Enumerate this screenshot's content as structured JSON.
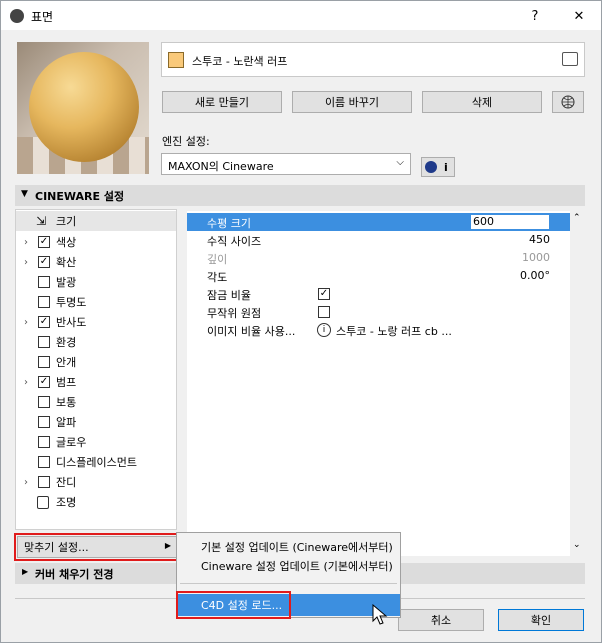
{
  "window": {
    "title": "표면",
    "help": "?",
    "close": "✕"
  },
  "material": {
    "name": "스투코 - 노란색 러프",
    "color": "#f9c97a"
  },
  "buttons": {
    "new": "새로 만들기",
    "rename": "이름 바꾸기",
    "delete": "삭제"
  },
  "engine": {
    "label": "엔진 설정:",
    "value": "MAXON의 Cineware",
    "info": "i"
  },
  "cineware": {
    "header": "CINEWARE 설정"
  },
  "channels": [
    {
      "label": "크기",
      "type": "size"
    },
    {
      "label": "색상",
      "checked": true,
      "expand": true
    },
    {
      "label": "확산",
      "checked": true,
      "expand": true
    },
    {
      "label": "발광",
      "checked": false
    },
    {
      "label": "투명도",
      "checked": false
    },
    {
      "label": "반사도",
      "checked": true,
      "expand": true
    },
    {
      "label": "환경",
      "checked": false
    },
    {
      "label": "안개",
      "checked": false
    },
    {
      "label": "범프",
      "checked": true,
      "expand": true
    },
    {
      "label": "보통",
      "checked": false
    },
    {
      "label": "알파",
      "checked": false
    },
    {
      "label": "글로우",
      "checked": false
    },
    {
      "label": "디스플레이스먼트",
      "checked": false
    },
    {
      "label": "잔디",
      "checked": false,
      "expand": true
    },
    {
      "label": "조명",
      "type": "lock"
    }
  ],
  "properties": {
    "h_size": {
      "label": "수평 크기",
      "value": "600"
    },
    "v_size": {
      "label": "수직 사이즈",
      "value": "450"
    },
    "depth": {
      "label": "깊이",
      "value": "1000"
    },
    "angle": {
      "label": "각도",
      "value": "0.00°"
    },
    "lock_ratio": {
      "label": "잠금 비율",
      "checked": true
    },
    "random_origin": {
      "label": "무작위 원점",
      "checked": false
    },
    "image_ratio": {
      "label": "이미지 비율 사용...",
      "value": "스투코 - 노랑 러프 cb ..."
    }
  },
  "fit_settings": {
    "label": "맞추기 설정...",
    "arrow": "▶"
  },
  "cover_fill": {
    "label": "커버 채우기 전경"
  },
  "menu": {
    "update_defaults": "기본 설정 업데이트 (Cineware에서부터)",
    "update_cineware": "Cineware 설정 업데이트 (기본에서부터)",
    "load_c4d": "C4D 설정 로드..."
  },
  "footer": {
    "cancel": "취소",
    "ok": "확인"
  }
}
